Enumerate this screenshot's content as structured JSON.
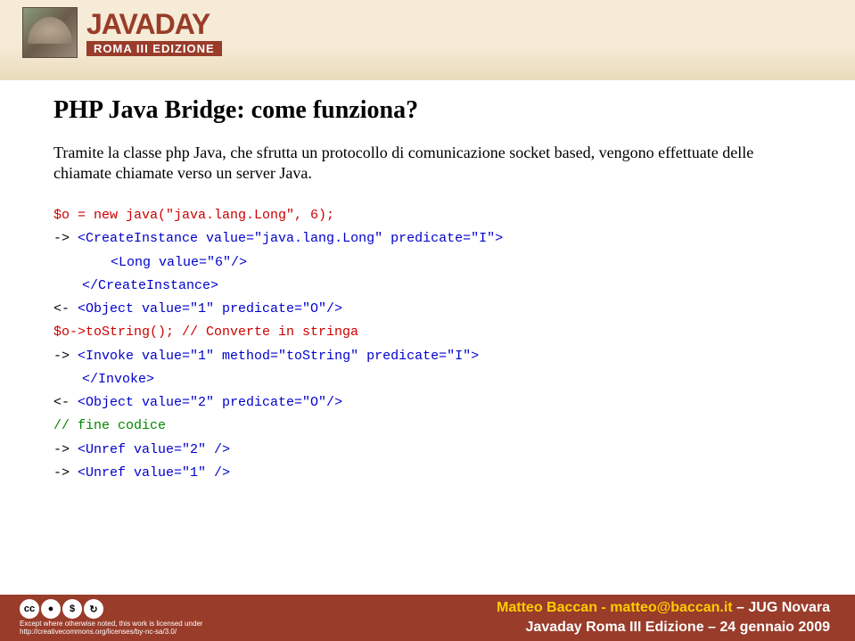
{
  "header": {
    "brand": "JAVADAY",
    "edition": "ROMA III EDIZIONE"
  },
  "main": {
    "title": "PHP Java Bridge: come funziona?",
    "description": "Tramite la classe php Java, che sfrutta un protocollo di comunicazione socket based, vengono effettuate delle chiamate chiamate verso un server Java.",
    "code": {
      "line1": "$o = new java(\"java.lang.Long\", 6);",
      "line2a": "-> ",
      "line2b": "<CreateInstance value=\"java.lang.Long\" predicate=\"I\">",
      "line3": "<Long value=\"6\"/>",
      "line4": "</CreateInstance>",
      "line5a": "<- ",
      "line5b": "<Object value=\"1\" predicate=\"O\"/>",
      "line6": "$o->toString(); // Converte in stringa",
      "line7a": "-> ",
      "line7b": "<Invoke value=\"1\" method=\"toString\" predicate=\"I\">",
      "line8": "</Invoke>",
      "line9a": "<- ",
      "line9b": "<Object value=\"2\" predicate=\"O\"/>",
      "line10": "// fine codice",
      "line11a": "-> ",
      "line11b": "<Unref value=\"2\" />",
      "line12a": "-> ",
      "line12b": "<Unref value=\"1\" />"
    }
  },
  "footer": {
    "cc_line1": "Except where otherwise noted, this work is licensed under",
    "cc_line2": "http://creativecommons.org/licenses/by-nc-sa/3.0/",
    "author": "Matteo Baccan - matteo@baccan.it",
    "jug": " – JUG Novara",
    "event": "Javaday Roma III Edizione – 24 gennaio 2009"
  }
}
